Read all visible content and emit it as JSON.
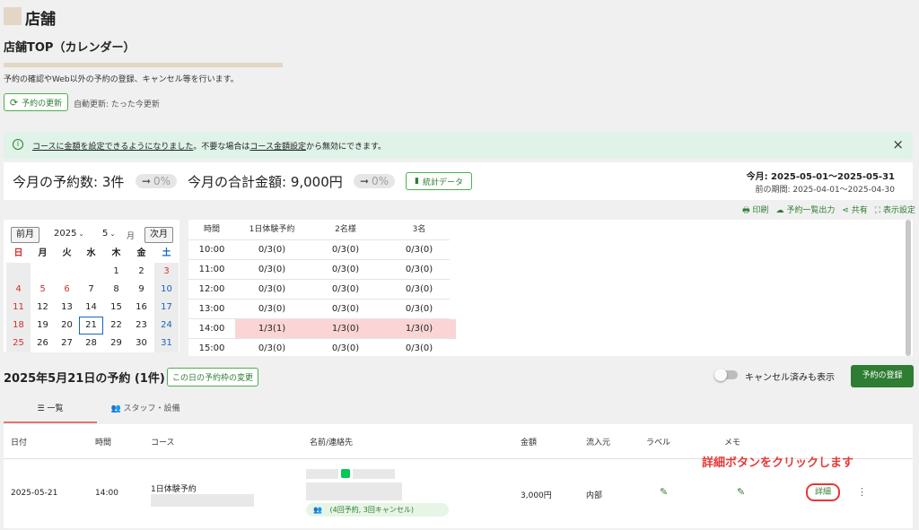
{
  "page": {
    "section_title": "店舗",
    "subtitle": "店舗TOP（カレンダー）",
    "description": "予約の確認やWeb以外の予約の登録、キャンセル等を行います。",
    "refresh_button": "予約の更新",
    "auto_refresh": "自動更新: たった今更新"
  },
  "notice": {
    "link1": "コースに金額を設定できるようになりました",
    "text1": "。不要な場合は",
    "link2": "コース金額設定",
    "text2": "から無効にできます。",
    "close": "×"
  },
  "stats": {
    "bookings_label": "今月の予約数: 3件",
    "bookings_change": "0%",
    "amount_label": "今月の合計金額: 9,000円",
    "amount_change": "0%",
    "stats_button": "統計データ",
    "period_current": "今月: 2025-05-01〜2025-05-31",
    "period_prev": "前の期間: 2025-04-01〜2025-04-30"
  },
  "toolbar": {
    "print": "印刷",
    "export": "予約一覧出力",
    "share": "共有",
    "display": "表示設定"
  },
  "calendar": {
    "prev": "前月",
    "next": "次月",
    "year": "2025",
    "month": "5",
    "month_suffix": "月",
    "weekdays": [
      "日",
      "月",
      "火",
      "水",
      "木",
      "金",
      "土"
    ],
    "weeks": [
      [
        "",
        "",
        "",
        "",
        "1",
        "2",
        "3"
      ],
      [
        "4",
        "5",
        "6",
        "7",
        "8",
        "9",
        "10"
      ],
      [
        "11",
        "12",
        "13",
        "14",
        "15",
        "16",
        "17"
      ],
      [
        "18",
        "19",
        "20",
        "21",
        "22",
        "23",
        "24"
      ],
      [
        "25",
        "26",
        "27",
        "28",
        "29",
        "30",
        "31"
      ]
    ],
    "selected": "21"
  },
  "slots": {
    "headers": [
      "時間",
      "1日体験予約",
      "2名様",
      "3名"
    ],
    "rows": [
      [
        "10:00",
        "0/3(0)",
        "0/3(0)",
        "0/3(0)"
      ],
      [
        "11:00",
        "0/3(0)",
        "0/3(0)",
        "0/3(0)"
      ],
      [
        "12:00",
        "0/3(0)",
        "0/3(0)",
        "0/3(0)"
      ],
      [
        "13:00",
        "0/3(0)",
        "0/3(0)",
        "0/3(0)"
      ],
      [
        "14:00",
        "1/3(1)",
        "1/3(0)",
        "1/3(0)"
      ],
      [
        "15:00",
        "0/3(0)",
        "0/3(0)",
        "0/3(0)"
      ]
    ]
  },
  "day": {
    "title": "2025年5月21日の予約 (1件)",
    "change_slots": "この日の予約枠の変更",
    "show_cancelled": "キャンセル済みも表示",
    "register": "予約の登録",
    "tab_list": "一覧",
    "tab_staff": "スタッフ・設備"
  },
  "table": {
    "headers": [
      "日付",
      "時間",
      "コース",
      "名前/連絡先",
      "金額",
      "流入元",
      "ラベル",
      "メモ"
    ],
    "row": {
      "date": "2025-05-21",
      "time": "14:00",
      "course": "1日体験予約",
      "history": "(4回予約, 3回キャンセル)",
      "amount": "3,000円",
      "source": "内部",
      "detail": "詳細"
    }
  },
  "annotation": "詳細ボタンをクリックします",
  "colors": {
    "accent_green": "#2e7d32",
    "annotation_red": "#e53935",
    "notice_bg": "#dff3e8",
    "highlight": "#fbd5d5"
  }
}
